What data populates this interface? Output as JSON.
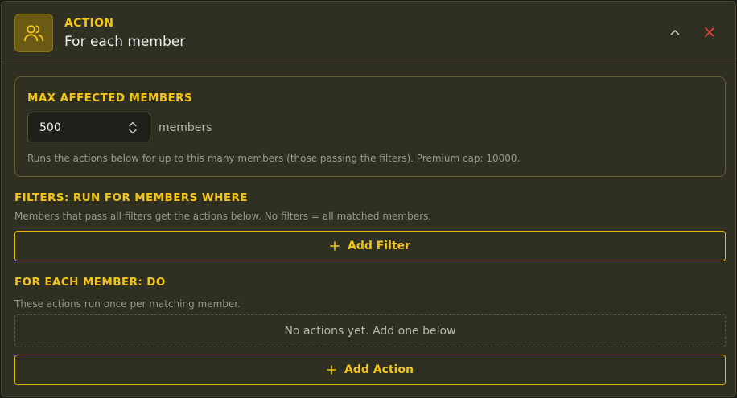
{
  "header": {
    "kicker": "ACTION",
    "title": "For each member",
    "icon": "users-icon"
  },
  "max_affected": {
    "label": "MAX AFFECTED MEMBERS",
    "value": "500",
    "unit": "members",
    "help": "Runs the actions below for up to this many members (those passing the filters). Premium cap: 10000."
  },
  "filters": {
    "label": "FILTERS: RUN FOR MEMBERS WHERE",
    "help": "Members that pass all filters get the actions below. No filters = all matched members.",
    "add_label": "Add Filter"
  },
  "for_each": {
    "label": "FOR EACH MEMBER: DO",
    "help": "These actions run once per matching member.",
    "empty_text": "No actions yet. Add one below",
    "add_label": "Add Action"
  },
  "colors": {
    "accent": "#f2c318",
    "danger": "#e0403a",
    "background": "#2f3022"
  }
}
